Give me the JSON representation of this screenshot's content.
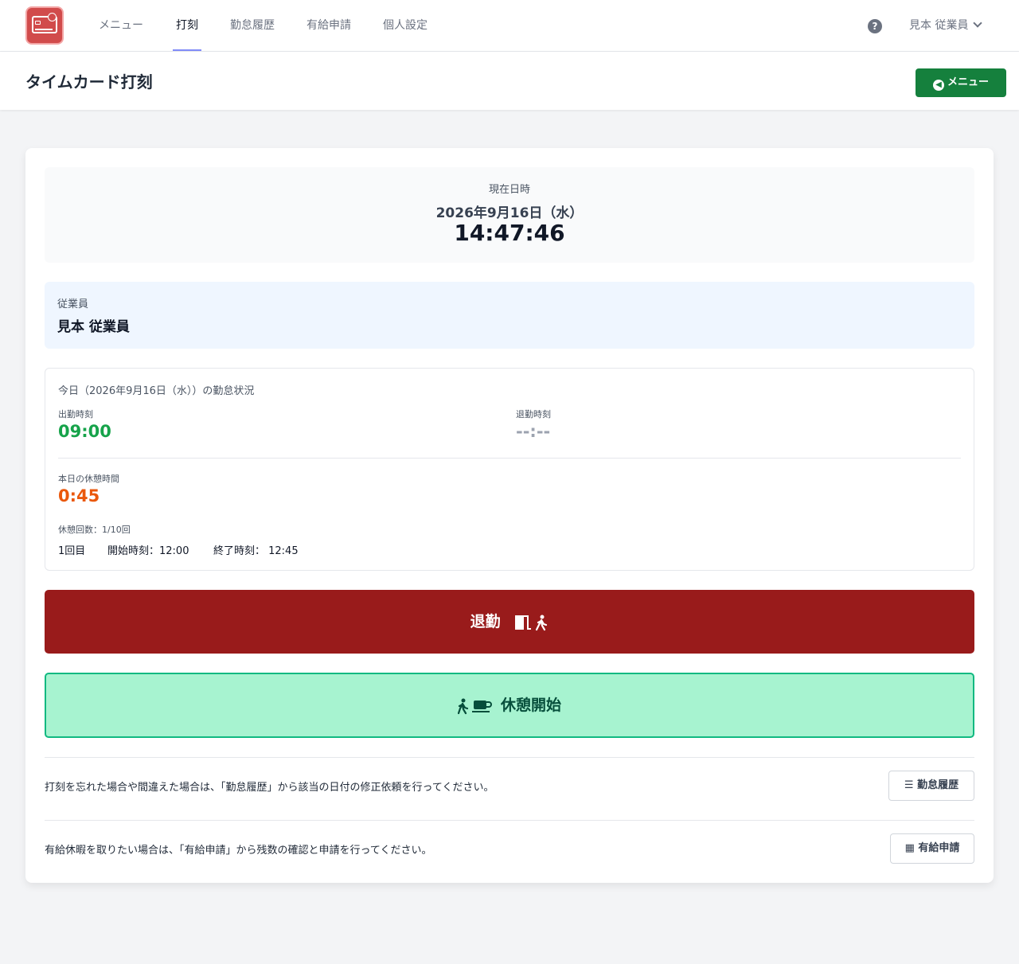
{
  "nav": {
    "items": [
      {
        "label": "メニュー"
      },
      {
        "label": "打刻"
      },
      {
        "label": "勤怠履歴"
      },
      {
        "label": "有給申請"
      },
      {
        "label": "個人設定"
      }
    ],
    "active_index": 1,
    "help_icon": "question-circle-icon",
    "user_name": "見本 従業員"
  },
  "header": {
    "title": "タイムカード打刻",
    "menu_button": "メニュー"
  },
  "clock": {
    "label": "現在日時",
    "date": "2026年9月16日（水）",
    "time": "14:47:46"
  },
  "employee": {
    "label": "従業員",
    "name": "見本 従業員"
  },
  "status": {
    "title": "今日（2026年9月16日（水））の勤怠状況",
    "clock_in_label": "出勤時刻",
    "clock_in_value": "09:00",
    "clock_out_label": "退勤時刻",
    "clock_out_value": "--:--",
    "break_total_label": "本日の休憩時間",
    "break_total_value": "0:45",
    "break_count": "休憩回数：1/10回",
    "breaks": [
      {
        "nth": "1回目",
        "start": "開始時刻：12:00",
        "end": "終了時刻： 12:45"
      }
    ]
  },
  "actions": {
    "checkout_label": "退勤",
    "break_start_label": "休憩開始"
  },
  "notes": {
    "history_text": "打刻を忘れた場合や間違えた場合は、「勤怠履歴」から該当の日付の修正依頼を行ってください。",
    "history_button": "勤怠履歴",
    "leave_text": "有給休暇を取りたい場合は、「有給申請」から残数の確認と申請を行ってください。",
    "leave_button": "有給申請"
  },
  "colors": {
    "clock_in": "#16a34a",
    "clock_out": "#9ca3af",
    "break_total": "#ea580c",
    "checkout_bg": "#991b1b",
    "break_bg": "#a7f3d0",
    "menu_btn": "#15803d"
  }
}
